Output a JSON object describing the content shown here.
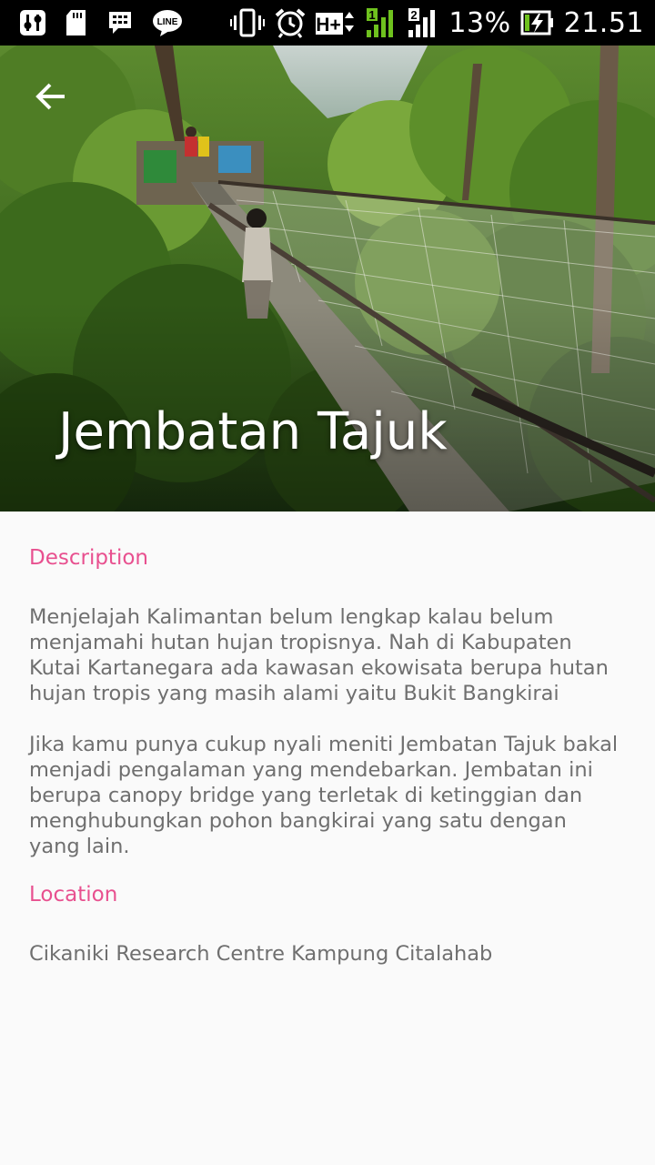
{
  "status_bar": {
    "left_icons": [
      "settings-adjust-icon",
      "sd-card-icon",
      "bbm-icon",
      "line-app-icon"
    ],
    "line_label": "LINE",
    "right_icons": [
      "vibrate-icon",
      "alarm-icon",
      "network-hplus-icon",
      "signal-sim1-icon",
      "signal-sim2-icon",
      "battery-charging-icon"
    ],
    "network_type": "H+",
    "sim1_label": "1",
    "sim2_label": "2",
    "battery_percent": "13%",
    "time": "21.51"
  },
  "header": {
    "back_icon": "arrow-left-icon",
    "title": "Jembatan Tajuk"
  },
  "description": {
    "heading": "Description",
    "paragraphs": [
      "Menjelajah Kalimantan belum lengkap kalau belum menjamahi hutan hujan tropisnya. Nah di Kabupaten Kutai Kartanegara ada kawasan ekowisata berupa hutan hujan tropis yang masih alami yaitu Bukit Bangkirai",
      "Jika kamu punya cukup nyali meniti Jembatan Tajuk bakal menjadi pengalaman yang mendebarkan. Jembatan ini berupa canopy bridge yang terletak di ketinggian dan menghubungkan pohon bangkirai yang satu dengan yang lain."
    ]
  },
  "location": {
    "heading": "Location",
    "text": "Cikaniki Research Centre Kampung Citalahab"
  },
  "colors": {
    "accent": "#e8508f",
    "body_text": "#6f6f6f",
    "background": "#fafafa",
    "status_bar": "#000000",
    "signal_green": "#6fc21e"
  }
}
